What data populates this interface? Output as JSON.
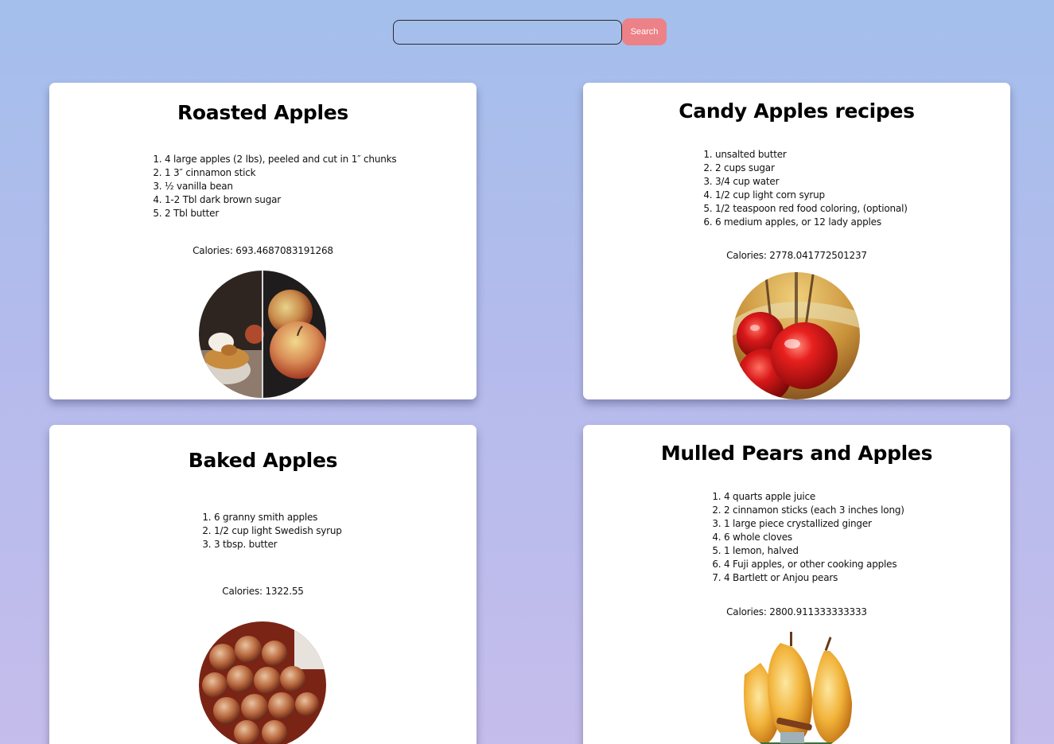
{
  "search": {
    "placeholder": "",
    "value": "",
    "button_label": "Search"
  },
  "recipes": [
    {
      "title": "Roasted Apples",
      "ingredients": [
        "4 large apples (2 lbs), peeled and cut in 1″ chunks",
        "1 3″ cinnamon stick",
        "½ vanilla bean",
        "1-2 Tbl dark brown sugar",
        "2 Tbl butter"
      ],
      "calories": "Calories: 693.4687083191268",
      "image_icon": "roasted-apples-photo"
    },
    {
      "title": "Candy Apples recipes",
      "ingredients": [
        "unsalted butter",
        "2 cups sugar",
        "3/4 cup water",
        "1/2 cup light corn syrup",
        "1/2 teaspoon red food coloring, (optional)",
        "6 medium apples, or 12 lady apples"
      ],
      "calories": "Calories: 2778.041772501237",
      "image_icon": "candy-apples-photo"
    },
    {
      "title": "Baked Apples",
      "ingredients": [
        "6 granny smith apples",
        "1/2 cup light Swedish syrup",
        "3 tbsp. butter"
      ],
      "calories": "Calories: 1322.55",
      "image_icon": "baked-apples-photo"
    },
    {
      "title": "Mulled Pears and Apples",
      "ingredients": [
        "4 quarts apple juice",
        "2 cinnamon sticks (each 3 inches long)",
        "1 large piece crystallized ginger",
        "6 whole cloves",
        "1 lemon, halved",
        "4 Fuji apples, or other cooking apples",
        "4 Bartlett or Anjou pears"
      ],
      "calories": "Calories: 2800.911333333333",
      "image_icon": "mulled-pears-photo"
    }
  ],
  "colors": {
    "search_button": "#ec8187",
    "card_background": "#ffffff",
    "page_gradient_top": "#a4bfec",
    "page_gradient_bottom": "#c5bdeb"
  }
}
